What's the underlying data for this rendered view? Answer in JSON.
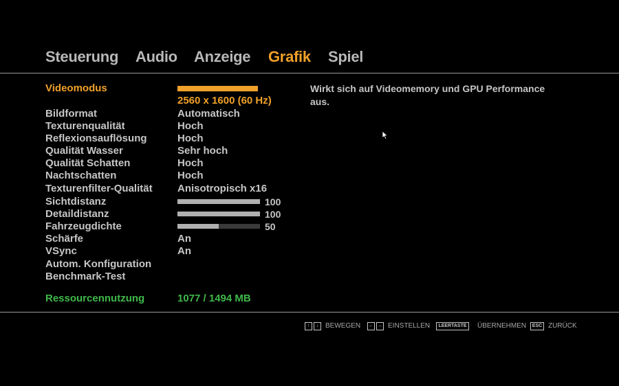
{
  "tabs": [
    {
      "label": "Steuerung",
      "active": false
    },
    {
      "label": "Audio",
      "active": false
    },
    {
      "label": "Anzeige",
      "active": false
    },
    {
      "label": "Grafik",
      "active": true
    },
    {
      "label": "Spiel",
      "active": false
    }
  ],
  "settings": [
    {
      "label": "Videomodus",
      "value": "2560 x 1600 (60 Hz)"
    },
    {
      "label": "Bildformat",
      "value": "Automatisch"
    },
    {
      "label": "Texturenqualität",
      "value": "Hoch"
    },
    {
      "label": "Reflexionsauflösung",
      "value": "Hoch"
    },
    {
      "label": "Qualität Wasser",
      "value": "Sehr hoch"
    },
    {
      "label": "Qualität Schatten",
      "value": "Hoch"
    },
    {
      "label": "Nachtschatten",
      "value": "Hoch"
    },
    {
      "label": "Texturenfilter-Qualität",
      "value": "Anisotropisch x16"
    },
    {
      "label": "Sichtdistanz",
      "value": "100",
      "level": 100
    },
    {
      "label": "Detaildistanz",
      "value": "100",
      "level": 100
    },
    {
      "label": "Fahrzeugdichte",
      "value": "50",
      "level": 50
    },
    {
      "label": "Schärfe",
      "value": "An"
    },
    {
      "label": "VSync",
      "value": "An"
    },
    {
      "label": "Autom. Konfiguration",
      "value": ""
    },
    {
      "label": "Benchmark-Test",
      "value": ""
    }
  ],
  "resource": {
    "label": "Ressourcennutzung",
    "value": "1077 / 1494 MB"
  },
  "description": "Wirkt sich auf Videomemory und GPU Performance aus.",
  "footer": {
    "move_label": "BEWEGEN",
    "adjust_label": "EINSTELLEN",
    "space_key": "LEERTASTE",
    "apply_label": "ÜBERNEHMEN",
    "esc_key": "ESC",
    "back_label": "ZURÜCK"
  },
  "colors": {
    "accent": "#f0a12a",
    "resource": "#3fb84a",
    "text": "#c6c6c6"
  }
}
